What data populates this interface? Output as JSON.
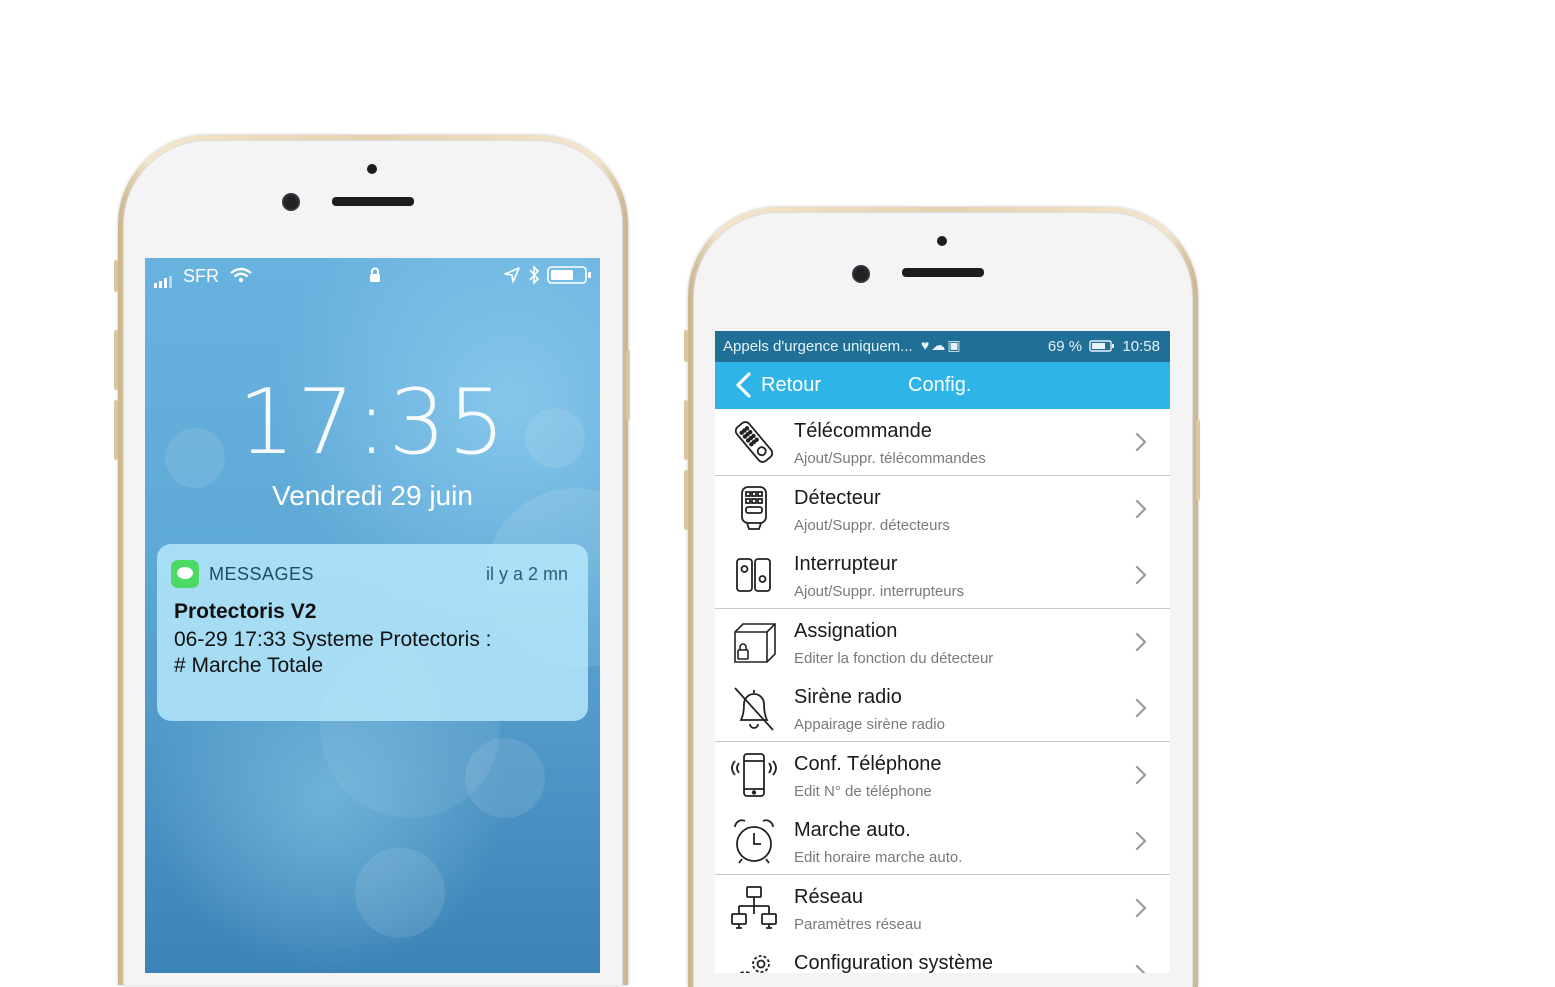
{
  "lock_screen": {
    "status": {
      "carrier": "SFR"
    },
    "time": "17:35",
    "date": "Vendredi 29 juin",
    "notification": {
      "app_name": "MESSAGES",
      "when": "il y a 2 mn",
      "title": "Protectoris V2",
      "body": "06-29 17:33 Systeme Protectoris :\n# Marche Totale"
    }
  },
  "config_screen": {
    "status": {
      "left_text": "Appels d'urgence uniquem...",
      "battery": "69 %",
      "clock": "10:58"
    },
    "appbar": {
      "back_label": "Retour",
      "title": "Config."
    },
    "items": [
      {
        "label": "Télécommande",
        "sub": "Ajout/Suppr. télécommandes",
        "icon": "remote-control-icon"
      },
      {
        "label": "Détecteur",
        "sub": "Ajout/Suppr. détecteurs",
        "icon": "detector-icon"
      },
      {
        "label": "Interrupteur",
        "sub": "Ajout/Suppr. interrupteurs",
        "icon": "switch-icon"
      },
      {
        "label": "Assignation",
        "sub": "Editer la fonction du détecteur",
        "icon": "box-lock-icon"
      },
      {
        "label": "Sirène radio",
        "sub": "Appairage sirène radio",
        "icon": "bell-off-icon"
      },
      {
        "label": "Conf. Téléphone",
        "sub": "Edit N° de téléphone",
        "icon": "phone-vibrate-icon"
      },
      {
        "label": "Marche auto.",
        "sub": "Edit horaire marche auto.",
        "icon": "alarm-clock-icon"
      },
      {
        "label": "Réseau",
        "sub": "Paramètres réseau",
        "icon": "network-icon"
      },
      {
        "label": "Configuration système",
        "sub": "",
        "icon": "gears-icon"
      }
    ]
  },
  "colors": {
    "appbar": "#2eb4e6",
    "android_status": "#1f6f96",
    "notification_bg": "#b4e6fa",
    "messages_green": "#4cd964",
    "phone_gold": "#e4d2ae"
  }
}
